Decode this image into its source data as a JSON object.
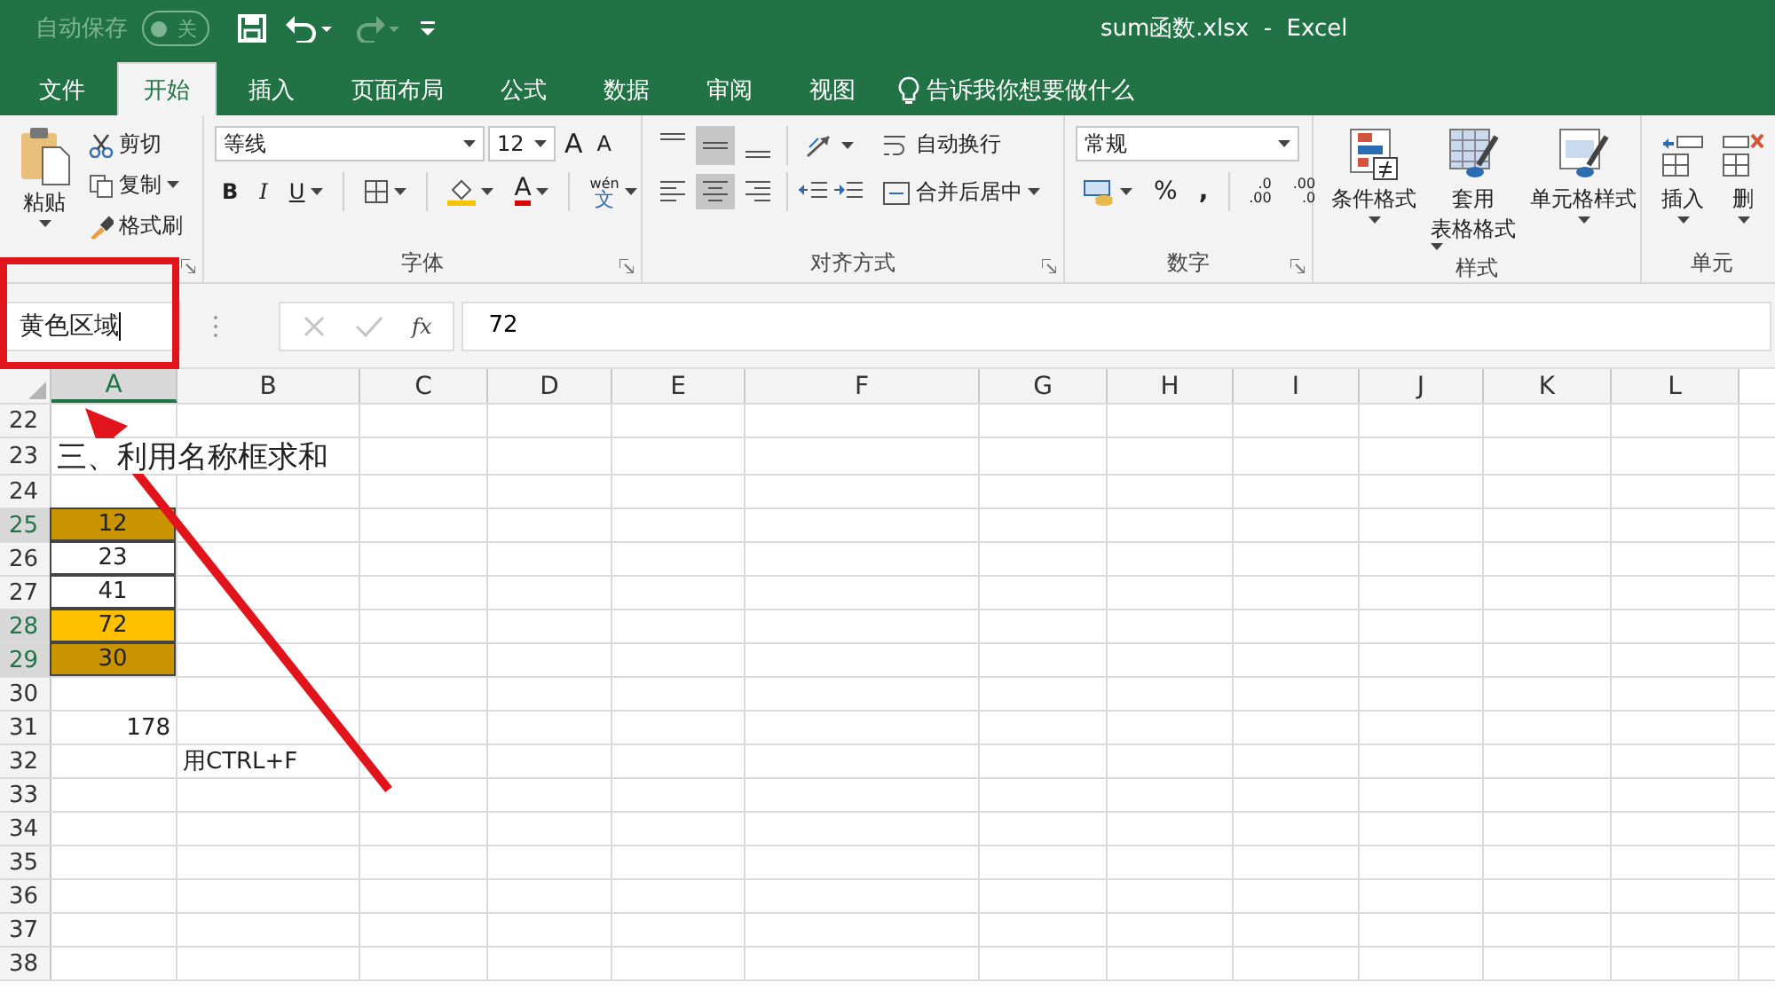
{
  "title_bar": {
    "autosave_label": "自动保存",
    "autosave_toggle": {
      "on": false,
      "label": "关"
    },
    "title": "sum函数.xlsx  -  Excel"
  },
  "tabs": [
    {
      "label": "文件",
      "selected": false
    },
    {
      "label": "开始",
      "selected": true
    },
    {
      "label": "插入",
      "selected": false
    },
    {
      "label": "页面布局",
      "selected": false
    },
    {
      "label": "公式",
      "selected": false
    },
    {
      "label": "数据",
      "selected": false
    },
    {
      "label": "审阅",
      "selected": false
    },
    {
      "label": "视图",
      "selected": false
    }
  ],
  "tell_me": "告诉我你想要做什么",
  "ribbon": {
    "groups": [
      {
        "kind": "clipboard",
        "paste": "粘贴",
        "cut": "剪切",
        "copy": "复制",
        "format_painter": "格式刷"
      },
      {
        "kind": "font",
        "label": "字体",
        "font_name": "等线",
        "font_size": "12",
        "grow": "A",
        "shrink": "A",
        "bold": "B",
        "italic": "I",
        "underline": "U",
        "font_color": "A",
        "phonetic_top": "wén",
        "phonetic_bottom": "文"
      },
      {
        "kind": "alignment",
        "label": "对齐方式",
        "wrap_text": "自动换行",
        "merge_center": "合并后居中",
        "vertical": [
          {
            "selected": false
          },
          {
            "selected": true
          },
          {
            "selected": false
          }
        ],
        "horizontal": [
          {
            "selected": false
          },
          {
            "selected": true
          },
          {
            "selected": false
          }
        ]
      },
      {
        "kind": "number",
        "label": "数字",
        "format": "常规",
        "percent": "%",
        "comma": ",",
        "increase_decimal": [
          ".0",
          ".00"
        ],
        "decrease_decimal": [
          ".00",
          ".0"
        ]
      },
      {
        "kind": "styles",
        "label": "样式",
        "conditional": "条件格式",
        "table_line1": "套用",
        "table_line2": "表格格式",
        "cell_styles": "单元格样式"
      },
      {
        "kind": "cells",
        "label": "单元",
        "insert": "插入",
        "delete": "删"
      }
    ]
  },
  "formula_bar": {
    "name_box": "黄色区域",
    "fx": "fx",
    "formula": "72"
  },
  "sheet": {
    "columns": [
      {
        "label": "A",
        "selected": true
      },
      {
        "label": "B",
        "selected": false
      },
      {
        "label": "C",
        "selected": false
      },
      {
        "label": "D",
        "selected": false
      },
      {
        "label": "E",
        "selected": false
      },
      {
        "label": "F",
        "selected": false
      },
      {
        "label": "G",
        "selected": false
      },
      {
        "label": "H",
        "selected": false
      },
      {
        "label": "I",
        "selected": false
      },
      {
        "label": "J",
        "selected": false
      },
      {
        "label": "K",
        "selected": false
      },
      {
        "label": "L",
        "selected": false
      }
    ],
    "rows": [
      {
        "number": "22",
        "selected": false
      },
      {
        "number": "23",
        "selected": false,
        "a": {
          "text": "三、利用名称框求和",
          "kind": "heading"
        }
      },
      {
        "number": "24",
        "selected": false
      },
      {
        "number": "25",
        "selected": true,
        "a": {
          "text": "12",
          "kind": "centered",
          "color": "#c99400",
          "boxed": true
        }
      },
      {
        "number": "26",
        "selected": false,
        "a": {
          "text": "23",
          "kind": "centered",
          "boxed": true
        }
      },
      {
        "number": "27",
        "selected": false,
        "a": {
          "text": "41",
          "kind": "centered",
          "boxed": true
        }
      },
      {
        "number": "28",
        "selected": true,
        "a": {
          "text": "72",
          "kind": "centered",
          "color": "#ffc000",
          "boxed": true
        }
      },
      {
        "number": "29",
        "selected": true,
        "a": {
          "text": "30",
          "kind": "centered",
          "color": "#c99400",
          "boxed": true
        }
      },
      {
        "number": "30",
        "selected": false
      },
      {
        "number": "31",
        "selected": false,
        "a": {
          "text": "178",
          "kind": "number"
        }
      },
      {
        "number": "32",
        "selected": false,
        "b": {
          "text": "用CTRL+F",
          "kind": "text"
        }
      },
      {
        "number": "33",
        "selected": false
      },
      {
        "number": "34",
        "selected": false
      },
      {
        "number": "35",
        "selected": false
      },
      {
        "number": "36",
        "selected": false
      },
      {
        "number": "37",
        "selected": false
      },
      {
        "number": "38",
        "selected": false
      }
    ]
  }
}
